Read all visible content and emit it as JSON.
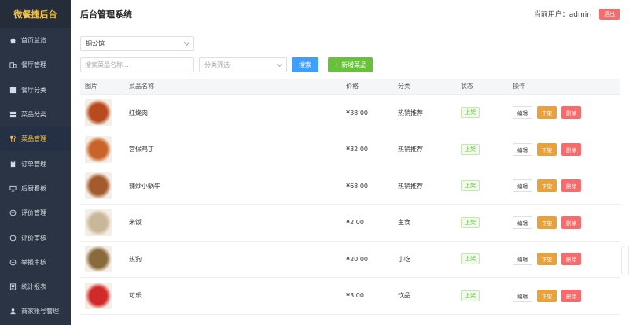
{
  "brand": "微餐捷后台",
  "header": {
    "title": "后台管理系统",
    "user_label": "当前用户：admin",
    "logout": "退出"
  },
  "nav": [
    {
      "label": "首页总览",
      "icon": "home-icon"
    },
    {
      "label": "餐厅管理",
      "icon": "building-icon"
    },
    {
      "label": "餐厅分类",
      "icon": "grid-icon"
    },
    {
      "label": "菜品分类",
      "icon": "grid-icon"
    },
    {
      "label": "菜品管理",
      "icon": "utensils-icon",
      "active": true
    },
    {
      "label": "订单管理",
      "icon": "clipboard-icon"
    },
    {
      "label": "后厨看板",
      "icon": "monitor-icon"
    },
    {
      "label": "评价管理",
      "icon": "chat-icon"
    },
    {
      "label": "评价审核",
      "icon": "chat-icon"
    },
    {
      "label": "举报审核",
      "icon": "chat-icon"
    },
    {
      "label": "统计报表",
      "icon": "chart-icon"
    },
    {
      "label": "商家账号管理",
      "icon": "user-icon"
    }
  ],
  "filters": {
    "restaurant": "铜公馆",
    "search_placeholder": "搜索菜品名称...",
    "category_placeholder": "分类筛选",
    "search_btn": "搜索",
    "add_btn": "+ 新增菜品"
  },
  "table": {
    "headers": [
      "图片",
      "菜品名称",
      "价格",
      "分类",
      "状态",
      "操作"
    ],
    "rows": [
      {
        "name": "红烧肉",
        "price": "¥38.00",
        "category": "热销推荐",
        "status": "上架",
        "img": "#b84a1e"
      },
      {
        "name": "宫保鸡丁",
        "price": "¥32.00",
        "category": "热销推荐",
        "status": "上架",
        "img": "#c8642a"
      },
      {
        "name": "辣炒小蜗牛",
        "price": "¥68.00",
        "category": "热销推荐",
        "status": "上架",
        "img": "#a35a2c"
      },
      {
        "name": "米饭",
        "price": "¥2.00",
        "category": "主食",
        "status": "上架",
        "img": "#c9b79a"
      },
      {
        "name": "热狗",
        "price": "¥20.00",
        "category": "小吃",
        "status": "上架",
        "img": "#8a6a3a"
      },
      {
        "name": "可乐",
        "price": "¥3.00",
        "category": "饮品",
        "status": "上架",
        "img": "#d02a2a"
      }
    ],
    "actions": {
      "edit": "编辑",
      "off": "下架",
      "del": "删除"
    }
  }
}
